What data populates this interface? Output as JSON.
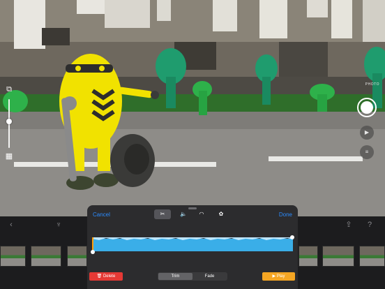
{
  "camera": {
    "mode_label": "PHOTO"
  },
  "edit_panel": {
    "cancel_label": "Cancel",
    "done_label": "Done",
    "tools": [
      {
        "icon": "scissors-icon",
        "active": true
      },
      {
        "icon": "volume-icon",
        "active": false
      },
      {
        "icon": "speed-gauge-icon",
        "active": false
      },
      {
        "icon": "filters-icon",
        "active": false
      }
    ],
    "delete_label": "Delete",
    "segments": [
      "Trim",
      "Fade"
    ],
    "selected_segment": "Trim",
    "play_label": "Play"
  },
  "toolbar": {
    "icons": [
      "back-chevron-icon",
      "microphone-icon",
      "share-icon",
      "help-icon"
    ]
  },
  "colors": {
    "accent": "#2b8cff",
    "delete": "#e53935",
    "play": "#f5a623",
    "waveform": "#3aaee8"
  }
}
